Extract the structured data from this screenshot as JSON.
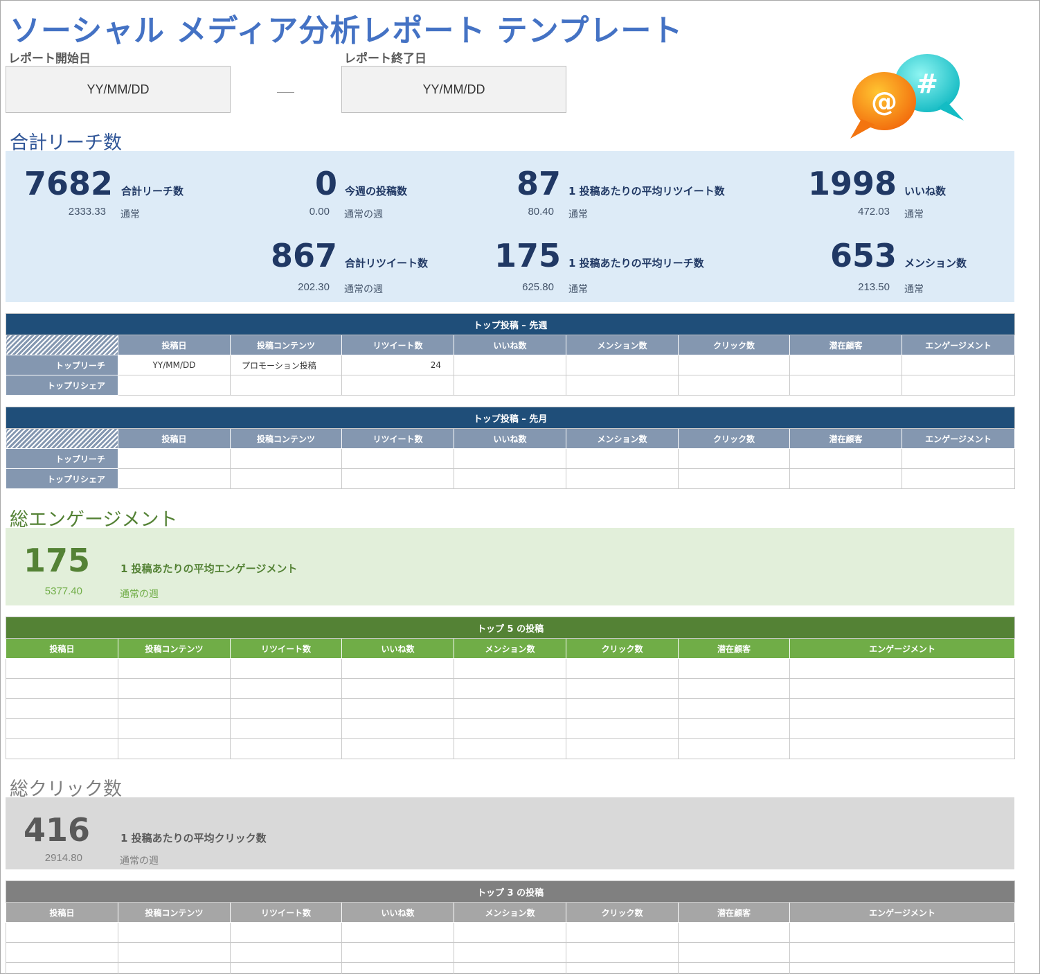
{
  "title": "ソーシャル メディア分析レポート テンプレート",
  "dates": {
    "start_label": "レポート開始日",
    "start_value": "YY/MM/DD",
    "end_label": "レポート終了日",
    "end_value": "YY/MM/DD"
  },
  "reach": {
    "section_title": "合計リーチ数",
    "kpis": [
      {
        "value": "7682",
        "label": "合計リーチ数",
        "sub": "2333.33",
        "sublabel": "通常"
      },
      {
        "value": "0",
        "label": "今週の投稿数",
        "sub": "0.00",
        "sublabel": "通常の週"
      },
      {
        "value": "87",
        "label": "1 投稿あたりの平均リツイート数",
        "sub": "80.40",
        "sublabel": "通常"
      },
      {
        "value": "1998",
        "label": "いいね数",
        "sub": "472.03",
        "sublabel": "通常"
      },
      {
        "value": "867",
        "label": "合計リツイート数",
        "sub": "202.30",
        "sublabel": "通常の週"
      },
      {
        "value": "175",
        "label": "1 投稿あたりの平均リーチ数",
        "sub": "625.80",
        "sublabel": "通常"
      },
      {
        "value": "653",
        "label": "メンション数",
        "sub": "213.50",
        "sublabel": "通常"
      }
    ]
  },
  "top_last_week": {
    "caption": "トップ投稿 – 先週",
    "columns": [
      "投稿日",
      "投稿コンテンツ",
      "リツイート数",
      "いいね数",
      "メンション数",
      "クリック数",
      "潜在顧客",
      "エンゲージメント"
    ],
    "row_labels": [
      "トップリーチ",
      "トップリシェア"
    ],
    "rows": [
      [
        "YY/MM/DD",
        "プロモーション投稿",
        "24",
        "",
        "",
        "",
        "",
        ""
      ],
      [
        "",
        "",
        "",
        "",
        "",
        "",
        "",
        ""
      ]
    ]
  },
  "top_last_month": {
    "caption": "トップ投稿 – 先月",
    "columns": [
      "投稿日",
      "投稿コンテンツ",
      "リツイート数",
      "いいね数",
      "メンション数",
      "クリック数",
      "潜在顧客",
      "エンゲージメント"
    ],
    "row_labels": [
      "トップリーチ",
      "トップリシェア"
    ]
  },
  "engagement": {
    "section_title": "総エンゲージメント",
    "value": "175",
    "label": "1 投稿あたりの平均エンゲージメント",
    "sub": "5377.40",
    "sublabel": "通常の週"
  },
  "top5": {
    "caption": "トップ 5 の投稿",
    "columns": [
      "投稿日",
      "投稿コンテンツ",
      "リツイート数",
      "いいね数",
      "メンション数",
      "クリック数",
      "潜在顧客",
      "エンゲージメント"
    ]
  },
  "clicks": {
    "section_title": "総クリック数",
    "value": "416",
    "label": "1 投稿あたりの平均クリック数",
    "sub": "2914.80",
    "sublabel": "通常の週"
  },
  "top3": {
    "caption": "トップ 3 の投稿",
    "columns": [
      "投稿日",
      "投稿コンテンツ",
      "リツイート数",
      "いいね数",
      "メンション数",
      "クリック数",
      "潜在顧客",
      "エンゲージメント"
    ]
  },
  "colors": {
    "title_blue": "#4472c4",
    "navy": "#1f4e79",
    "reach_panel": "#ddebf7",
    "slate_header": "#8497b0",
    "green_dark": "#548235",
    "green_header": "#70ad47",
    "engagement_panel": "#e2efda",
    "gray_dark": "#808080",
    "gray_header": "#a6a6a6",
    "clicks_panel": "#d9d9d9"
  },
  "icons": [
    "at-sign-bubble-icon",
    "hashtag-bubble-icon"
  ]
}
